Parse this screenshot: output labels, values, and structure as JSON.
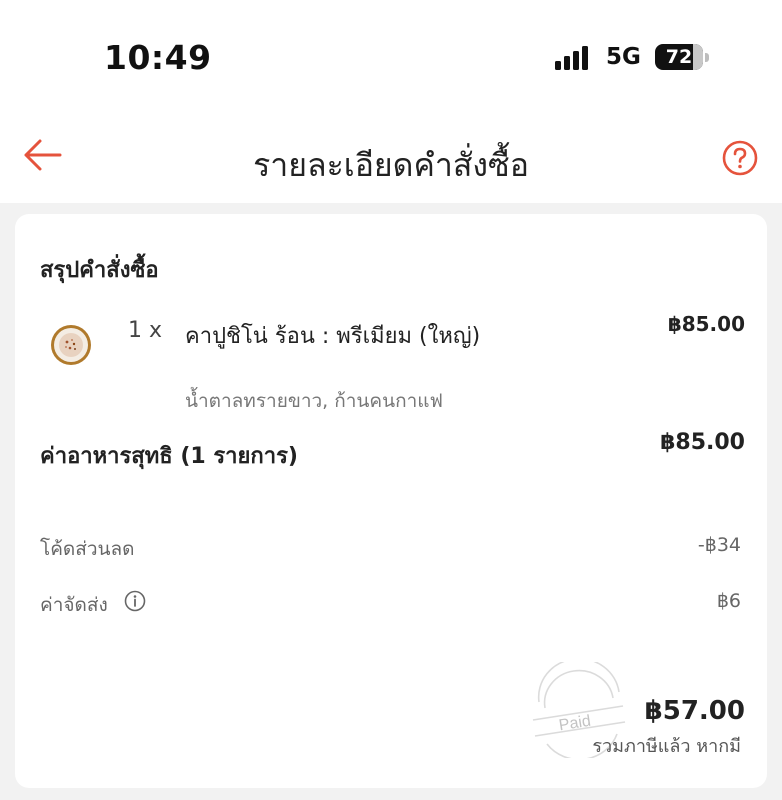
{
  "status_bar": {
    "time": "10:49",
    "network": "5G",
    "battery": "72"
  },
  "header": {
    "title": "รายละเอียดคำสั่งซื้อ",
    "back_icon": "arrow-left-icon",
    "help_icon": "question-circle-icon",
    "accent_color": "#E5533C"
  },
  "order_summary": {
    "title": "สรุปคำสั่งซื้อ",
    "items": [
      {
        "quantity": "1 x",
        "name": "คาปูชิโน่ ร้อน : พรีเมียม (ใหญ่)",
        "price": "฿85.00",
        "options": "น้ำตาลทรายขาว, ก้านคนกาแฟ"
      }
    ],
    "subtotal_label": "ค่าอาหารสุทธิ (1 รายการ)",
    "subtotal_value": "฿85.00",
    "discount_label": "โค้ดส่วนลด",
    "discount_value": "-฿34",
    "delivery_label": "ค่าจัดส่ง",
    "delivery_value": "฿6",
    "stamp_text": "Paid",
    "total": "฿57.00",
    "total_note": "รวมภาษีแล้ว หากมี"
  }
}
